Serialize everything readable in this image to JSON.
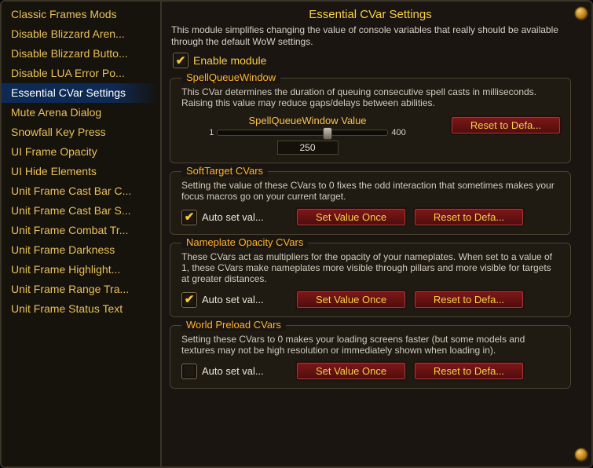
{
  "sidebar": {
    "items": [
      {
        "label": "Classic Frames Mods"
      },
      {
        "label": "Disable Blizzard Aren..."
      },
      {
        "label": "Disable Blizzard Butto..."
      },
      {
        "label": "Disable LUA Error Po..."
      },
      {
        "label": "Essential CVar Settings"
      },
      {
        "label": "Mute Arena Dialog"
      },
      {
        "label": "Snowfall Key Press"
      },
      {
        "label": "UI Frame Opacity"
      },
      {
        "label": "UI Hide Elements"
      },
      {
        "label": "Unit Frame Cast Bar C..."
      },
      {
        "label": "Unit Frame Cast Bar S..."
      },
      {
        "label": "Unit Frame Combat Tr..."
      },
      {
        "label": "Unit Frame Darkness"
      },
      {
        "label": "Unit Frame Highlight..."
      },
      {
        "label": "Unit Frame Range Tra..."
      },
      {
        "label": "Unit Frame Status Text"
      }
    ],
    "selected_index": 4
  },
  "header": {
    "title": "Essential CVar Settings",
    "desc": "This module simplifies changing the value of console variables that really should be available through the default WoW settings.",
    "enable_label": "Enable module",
    "enable_checked": true
  },
  "sections": [
    {
      "title": "SpellQueueWindow",
      "desc": "This CVar determines the duration of queuing consecutive spell casts in milliseconds. Raising this value may reduce gaps/delays between abilities.",
      "slider": {
        "label": "SpellQueueWindow Value",
        "min": "1",
        "max": "400",
        "value": "250",
        "thumb_pct": 62
      },
      "reset_label": "Reset to Defa..."
    },
    {
      "title": "SoftTarget CVars",
      "desc": "Setting the value of these CVars to 0 fixes the odd interaction that sometimes makes your focus macros go on your current target.",
      "auto": {
        "label": "Auto set val...",
        "checked": true
      },
      "set_label": "Set Value Once",
      "reset_label": "Reset to Defa..."
    },
    {
      "title": "Nameplate Opacity CVars",
      "desc": "These CVars act as multipliers for the opacity of your nameplates. When set to a value of 1, these CVars make nameplates more visible through pillars and more visible for targets at greater distances.",
      "auto": {
        "label": "Auto set val...",
        "checked": true
      },
      "set_label": "Set Value Once",
      "reset_label": "Reset to Defa..."
    },
    {
      "title": "World Preload CVars",
      "desc": "Setting these CVars to 0 makes your loading screens faster (but some models and textures may not be high resolution or immediately shown when loading in).",
      "auto": {
        "label": "Auto set val...",
        "checked": false
      },
      "set_label": "Set Value Once",
      "reset_label": "Reset to Defa..."
    }
  ]
}
